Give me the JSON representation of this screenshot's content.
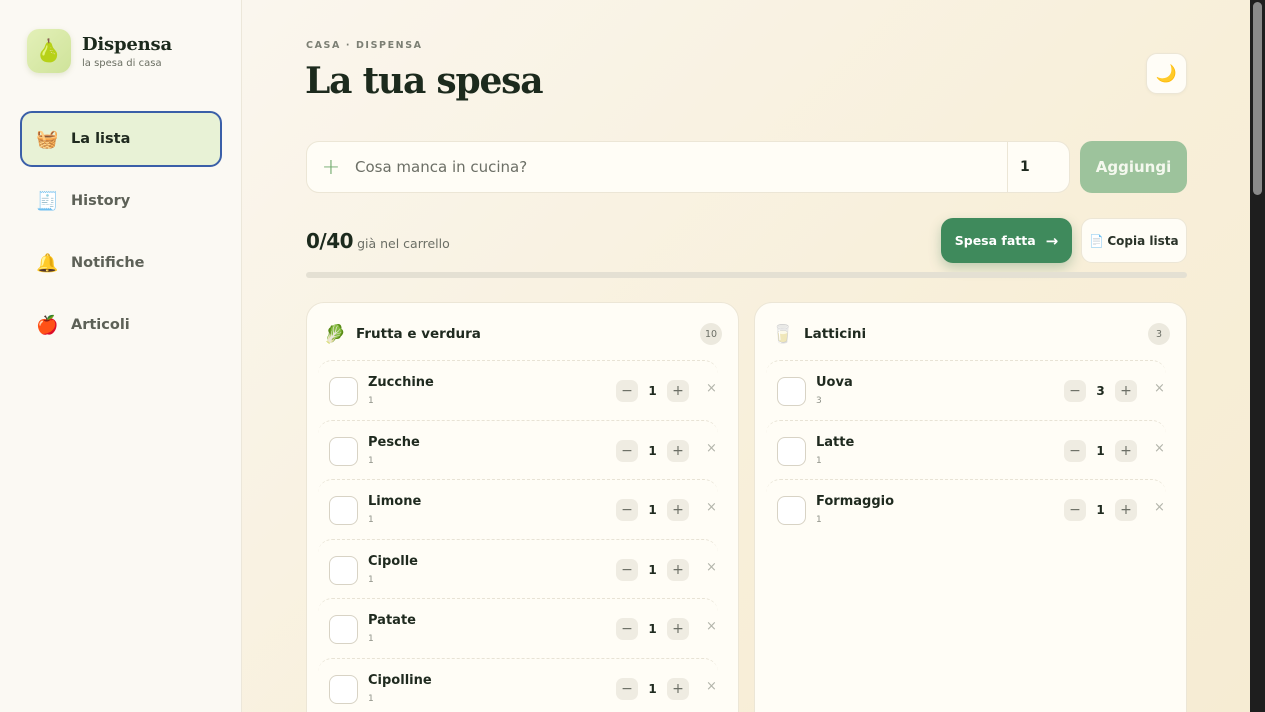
{
  "brand": {
    "name": "Dispensa",
    "subtitle": "la spesa di casa",
    "logo_icon": "🍐"
  },
  "nav": [
    {
      "icon": "🧺",
      "icon_name": "basket-icon",
      "label": "La lista",
      "active": true
    },
    {
      "icon": "🧾",
      "icon_name": "receipt-icon",
      "label": "History",
      "active": false
    },
    {
      "icon": "🔔",
      "icon_name": "bell-icon",
      "label": "Notifiche",
      "active": false
    },
    {
      "icon": "🍎",
      "icon_name": "apple-icon",
      "label": "Articoli",
      "active": false
    }
  ],
  "header": {
    "breadcrumb": "CASA · DISPENSA",
    "title": "La tua spesa",
    "theme_icon": "🌙"
  },
  "add_form": {
    "plus_icon": "+",
    "item_placeholder": "Cosa manca in cucina?",
    "item_value": "",
    "quantity_value": "1",
    "add_label": "Aggiungi"
  },
  "progress": {
    "count": "0/40",
    "label": "già nel carrello",
    "fraction": 0
  },
  "actions": {
    "done_label": "Spesa fatta",
    "done_arrow": "→",
    "copy_icon": "📄",
    "copy_label": "Copia lista"
  },
  "categories": [
    {
      "icon": "🥬",
      "icon_name": "leafy-greens-icon",
      "title": "Frutta e verdura",
      "count": "10",
      "items": [
        {
          "name": "Zucchine",
          "sub": "1",
          "qty": "1"
        },
        {
          "name": "Pesche",
          "sub": "1",
          "qty": "1"
        },
        {
          "name": "Limone",
          "sub": "1",
          "qty": "1"
        },
        {
          "name": "Cipolle",
          "sub": "1",
          "qty": "1"
        },
        {
          "name": "Patate",
          "sub": "1",
          "qty": "1"
        },
        {
          "name": "Cipolline",
          "sub": "1",
          "qty": "1"
        }
      ]
    },
    {
      "icon": "🥛",
      "icon_name": "glass-of-milk-icon",
      "title": "Latticini",
      "count": "3",
      "items": [
        {
          "name": "Uova",
          "sub": "3",
          "qty": "3"
        },
        {
          "name": "Latte",
          "sub": "1",
          "qty": "1"
        },
        {
          "name": "Formaggio",
          "sub": "1",
          "qty": "1"
        }
      ]
    }
  ],
  "stepper": {
    "minus": "−",
    "plus": "+",
    "remove": "×"
  },
  "colors": {
    "accent_green": "#3f8a5c",
    "add_button": "#9dc39c",
    "active_nav_bg": "#e8f2d6",
    "active_nav_border": "#3a5fa8"
  }
}
